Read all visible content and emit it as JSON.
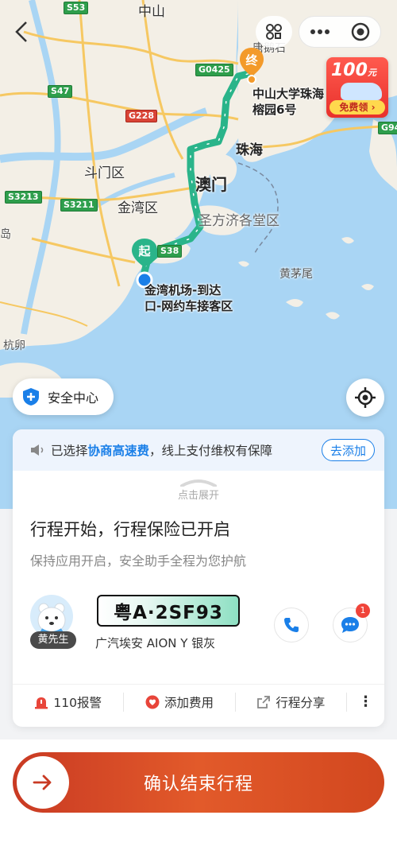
{
  "map": {
    "labels": {
      "zhongshan": "中山",
      "doumen": "斗门区",
      "jinwan": "金湾区",
      "zhuhai": "珠海",
      "macau": "澳门",
      "cotai": "圣方济各堂区",
      "huangmaowei": "黄茅尾",
      "dao": "岛",
      "hangluan": "杭卵",
      "tanghe": "唐鹅石"
    },
    "roads": {
      "s53": "S53",
      "s47": "S47",
      "g0425": "G0425",
      "g228": "G228",
      "s3213": "S3213",
      "s3211": "S3211",
      "s38": "S38",
      "g94": "G94"
    },
    "start_marker": "起",
    "end_marker": "终",
    "start_place": "金湾机场-到达\n口-网约车接客区",
    "end_place": "中山大学珠海\n榕园6号",
    "back_icon": "chevron-left-icon",
    "promo": {
      "amount": "100",
      "unit": "元",
      "cta": "免费领"
    },
    "safety_label": "安全中心"
  },
  "card": {
    "notice": {
      "prefix": "已选择",
      "highlight": "协商高速费",
      "suffix": "，线上支付维权有保障",
      "button": "去添加"
    },
    "expand_text": "点击展开",
    "title": "行程开始，行程保险已开启",
    "subtitle": "保持应用开启，安全助手全程为您护航",
    "driver": {
      "name": "黄先生",
      "plate": "粤A·2SF93",
      "car_model": "广汽埃安 AION Y 银灰",
      "message_badge": "1"
    },
    "actions": [
      {
        "label": "110报警",
        "icon": "alarm-icon"
      },
      {
        "label": "添加费用",
        "icon": "fee-icon"
      },
      {
        "label": "行程分享",
        "icon": "share-icon"
      }
    ],
    "more": "⋮"
  },
  "confirm": {
    "label": "确认结束行程"
  },
  "colors": {
    "route": "#2ab48a",
    "accent": "#1a7fe8",
    "confirm": "#d9452a",
    "badge": "#f0443a"
  }
}
